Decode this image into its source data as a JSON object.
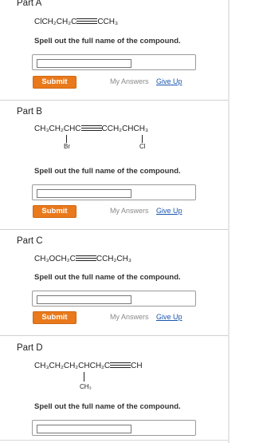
{
  "parts": [
    {
      "title": "Part A",
      "formula_pre": "ClCH₂CH₂C",
      "formula_post": "CCH₃",
      "prompt": "Spell out the full name of the compound.",
      "answer_value": "",
      "submit_label": "Submit",
      "my_answers_label": "My Answers",
      "give_up_label": "Give Up"
    },
    {
      "title": "Part B",
      "formula_pre": "CH₃CH₂CHC",
      "formula_post": "CCH₂CHCH₃",
      "substituent_left": "Br",
      "substituent_right": "Cl",
      "prompt": "Spell out the full name of the compound.",
      "answer_value": "",
      "submit_label": "Submit",
      "my_answers_label": "My Answers",
      "give_up_label": "Give Up"
    },
    {
      "title": "Part C",
      "formula_pre": "CH₃OCH₂C",
      "formula_post": "CCH₂CH₃",
      "prompt": "Spell out the full name of the compound.",
      "answer_value": "",
      "submit_label": "Submit",
      "my_answers_label": "My Answers",
      "give_up_label": "Give Up"
    },
    {
      "title": "Part D",
      "formula_pre": "CH₃CH₂CH₂CHCH₂C",
      "formula_post": "CH",
      "substituent": "CH₃",
      "prompt": "Spell out the full name of the compound.",
      "answer_value": ""
    }
  ],
  "colors": {
    "submit_bg": "#e9791b",
    "link": "#1a56b0",
    "muted": "#8a8a8a"
  }
}
